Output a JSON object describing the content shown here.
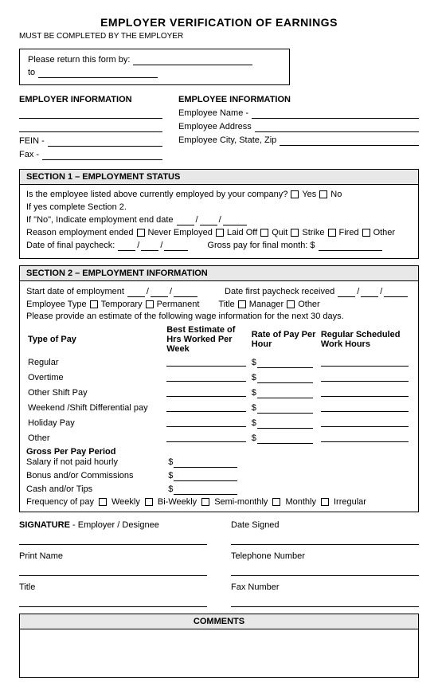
{
  "title": "EMPLOYER VERIFICATION OF EARNINGS",
  "subtitle": "MUST BE COMPLETED BY THE EMPLOYER",
  "return_form": {
    "label": "Please return this form by:",
    "to_label": "to"
  },
  "employer_info": {
    "title": "EMPLOYER INFORMATION",
    "fein_label": "FEIN -",
    "fax_label": "Fax -"
  },
  "employee_info": {
    "title": "EMPLOYEE INFORMATION",
    "name_label": "Employee Name -",
    "address_label": "Employee Address",
    "city_label": "Employee City, State, Zip"
  },
  "section1": {
    "title": "SECTION 1 – EMPLOYMENT STATUS",
    "question": "Is the employee listed above currently employed by your company?",
    "yes_label": "Yes",
    "no_label": "No",
    "if_no_note": "If yes complete Section 2.",
    "indicate_label": "If \"No\", Indicate employment end date",
    "reason_label": "Reason employment ended",
    "never_employed": "Never Employed",
    "laid_off": "Laid Off",
    "quit": "Quit",
    "strike": "Strike",
    "fired": "Fired",
    "other": "Other",
    "date_final_label": "Date of final paycheck:",
    "gross_final_label": "Gross pay for final month: $"
  },
  "section2": {
    "title": "SECTION 2 – EMPLOYMENT INFORMATION",
    "start_date_label": "Start date of employment",
    "first_paycheck_label": "Date first paycheck received",
    "employee_type_label": "Employee Type",
    "temporary_label": "Temporary",
    "permanent_label": "Permanent",
    "title_label": "Title",
    "manager_label": "Manager",
    "other_label": "Other",
    "wage_note": "Please provide an estimate of the following wage information for the next 30 days.",
    "table": {
      "col1": "Type of Pay",
      "col2": "Best Estimate of Hrs Worked Per Week",
      "col3": "Rate of Pay Per Hour",
      "col4": "Regular Scheduled Work Hours"
    },
    "rows": [
      {
        "type": "Regular"
      },
      {
        "type": "Overtime"
      },
      {
        "type": "Other Shift Pay"
      },
      {
        "type": "Weekend /Shift Differential pay"
      },
      {
        "type": "Holiday Pay"
      },
      {
        "type": "Other"
      }
    ],
    "gross_section": {
      "title": "Gross Per Pay Period",
      "rows": [
        {
          "label": "Salary if not paid hourly"
        },
        {
          "label": "Bonus and/or Commissions"
        },
        {
          "label": "Cash and/or Tips"
        }
      ]
    },
    "frequency_label": "Frequency of pay",
    "frequency_options": [
      "Weekly",
      "Bi-Weekly",
      "Semi-monthly",
      "Monthly",
      "Irregular"
    ]
  },
  "signature_section": {
    "sig_label": "SIGNATURE - Employer / Designee",
    "date_label": "Date Signed",
    "print_label": "Print Name",
    "phone_label": "Telephone Number",
    "title_label": "Title",
    "fax_label": "Fax Number"
  },
  "comments": {
    "title": "COMMENTS"
  }
}
